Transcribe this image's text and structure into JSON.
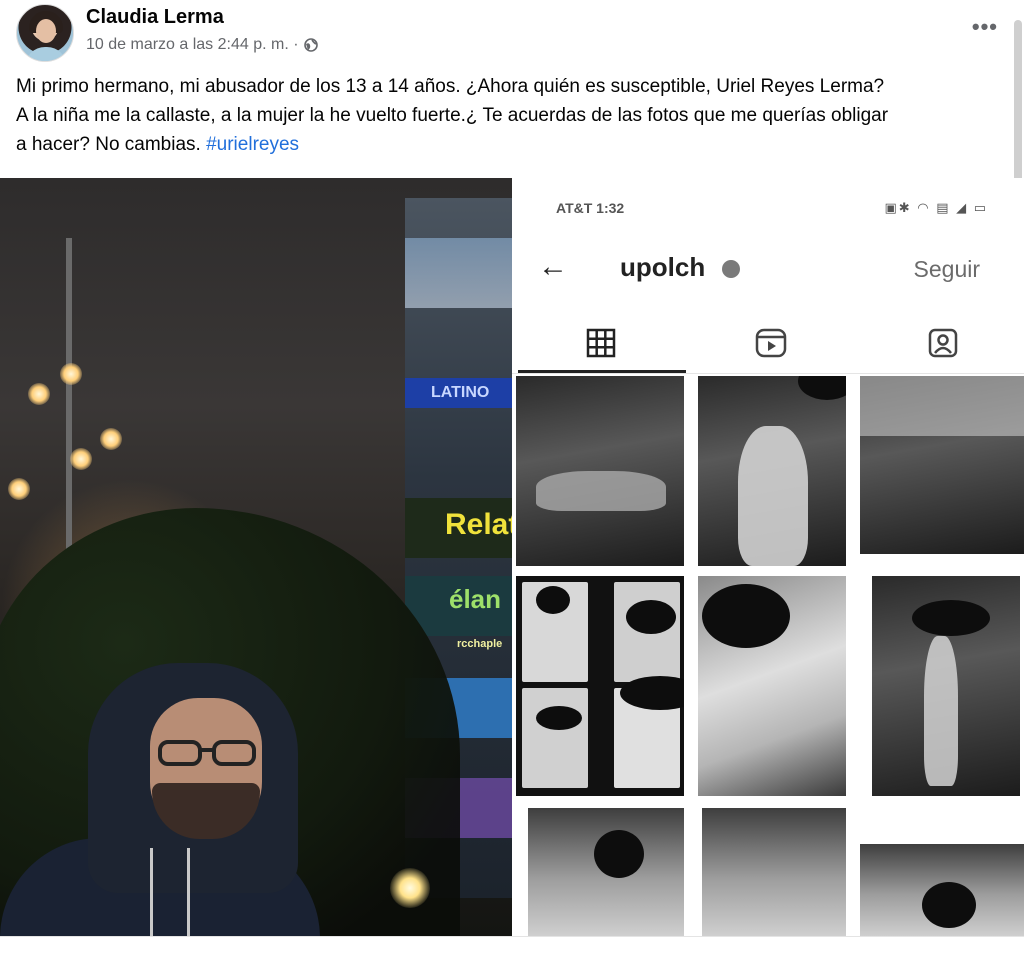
{
  "post": {
    "author": "Claudia Lerma",
    "timestamp": "10 de marzo a las 2:44 p. m. ·",
    "privacy_icon": "globe-icon",
    "more_icon": "more-options-icon",
    "more_label": "•••",
    "text_lines": [
      "Mi primo hermano, mi abusador de los 13 a 14 años. ¿Ahora quién es susceptible, Uriel Reyes Lerma?",
      "A la niña me la callaste, a la mujer la he vuelto fuerte.¿ Te acuerdas de las fotos que me querías obligar",
      "a hacer? No cambias. "
    ],
    "hashtag": "#urielreyes"
  },
  "left_photo": {
    "signs": [
      "LATINO",
      "Relat",
      "élan",
      "rcchaple"
    ]
  },
  "instagram": {
    "status_time": "AT&T 1:32",
    "status_icons": "▣✱ ◠ ▤ ◢ ▭",
    "back_icon": "←",
    "handle": "upolch",
    "follow_label": "Seguir",
    "tabs": [
      "grid-tab",
      "reels-tab",
      "tagged-tab"
    ]
  },
  "colors": {
    "hashtag": "#216fdb",
    "meta": "#65676b"
  }
}
